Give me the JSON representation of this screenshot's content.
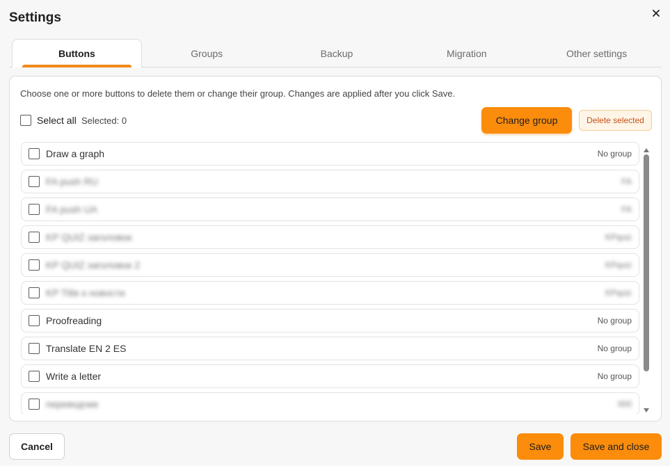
{
  "dialog": {
    "title": "Settings",
    "close_icon": "close-icon"
  },
  "tabs": [
    {
      "label": "Buttons",
      "active": true
    },
    {
      "label": "Groups",
      "active": false
    },
    {
      "label": "Backup",
      "active": false
    },
    {
      "label": "Migration",
      "active": false
    },
    {
      "label": "Other settings",
      "active": false
    }
  ],
  "panel": {
    "description": "Choose one or more buttons to delete them or change their group. Changes are applied after you click Save.",
    "select_all_label": "Select all",
    "selected_count": "Selected: 0",
    "change_group_label": "Change group",
    "delete_selected_label": "Delete selected"
  },
  "items": [
    {
      "name": "Draw a graph",
      "group": "No group",
      "blurred": false
    },
    {
      "name": "FA push RU",
      "group": "FA",
      "blurred": true
    },
    {
      "name": "FA push UA",
      "group": "FA",
      "blurred": true
    },
    {
      "name": "KP QUIZ заголовок",
      "group": "KPquiz",
      "blurred": true
    },
    {
      "name": "KP QUIZ заголовок 2",
      "group": "KPquiz",
      "blurred": true
    },
    {
      "name": "KP Title к новости",
      "group": "KPquiz",
      "blurred": true
    },
    {
      "name": "Proofreading",
      "group": "No group",
      "blurred": false
    },
    {
      "name": "Translate EN 2 ES",
      "group": "No group",
      "blurred": false
    },
    {
      "name": "Write a letter",
      "group": "No group",
      "blurred": false
    },
    {
      "name": "переводчик",
      "group": "000",
      "blurred": true
    }
  ],
  "footer": {
    "cancel_label": "Cancel",
    "save_label": "Save",
    "save_close_label": "Save and close"
  },
  "colors": {
    "accent": "#fb8c0c",
    "tab_indicator": "#f08a1a",
    "delete_text": "#c3501a",
    "delete_bg": "#fff5e6"
  }
}
